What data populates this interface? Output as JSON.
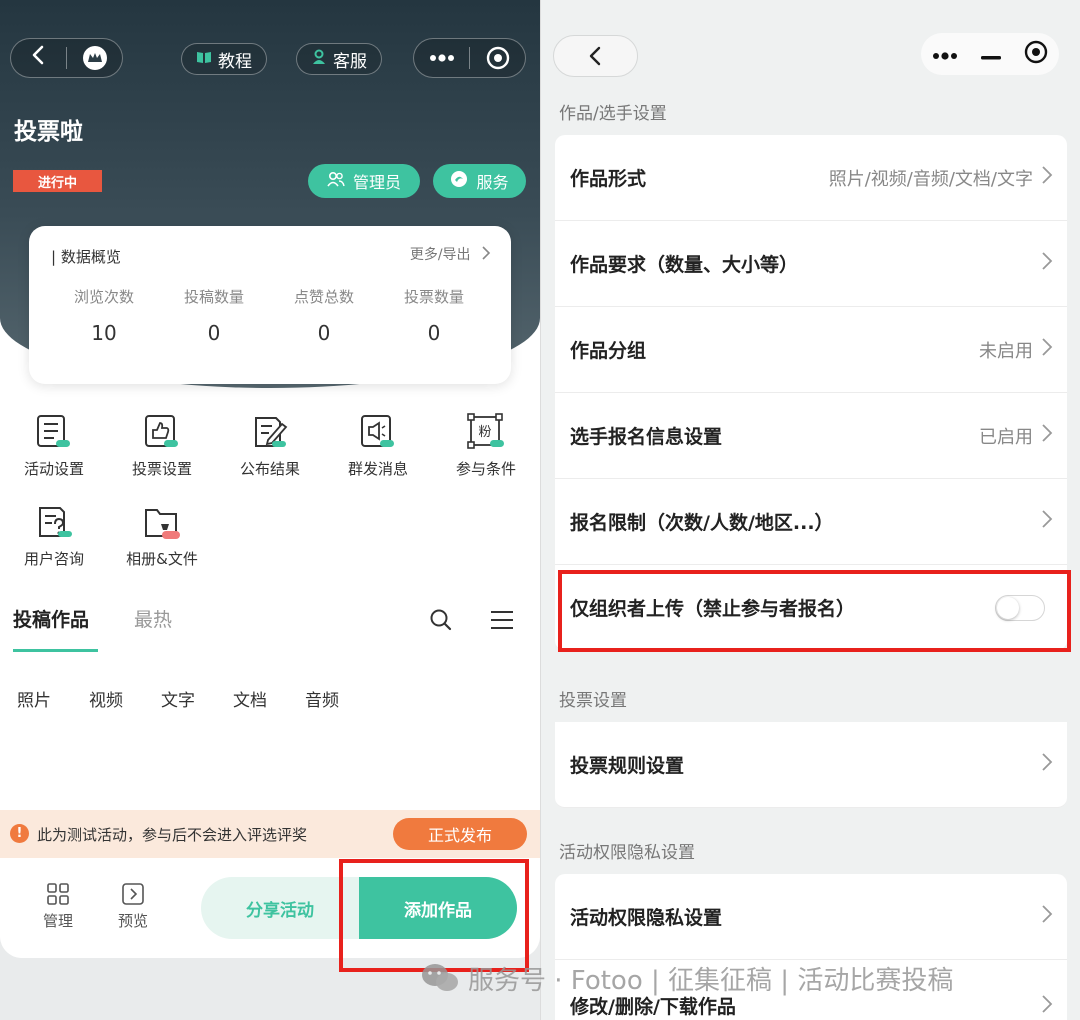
{
  "left": {
    "header": {
      "tutorial_label": "教程",
      "service_label": "客服"
    },
    "app_title": "投票啦",
    "status_tag": "进行中",
    "admin_button": "管理员",
    "service_button": "服务",
    "overview": {
      "title": "| 数据概览",
      "more_label": "更多/导出",
      "stats": [
        {
          "label": "浏览次数",
          "value": "10"
        },
        {
          "label": "投稿数量",
          "value": "0"
        },
        {
          "label": "点赞总数",
          "value": "0"
        },
        {
          "label": "投票数量",
          "value": "0"
        }
      ]
    },
    "grid": [
      {
        "label": "活动设置",
        "icon": "activity-settings-icon"
      },
      {
        "label": "投票设置",
        "icon": "thumbs-up-icon"
      },
      {
        "label": "公布结果",
        "icon": "edit-doc-icon"
      },
      {
        "label": "群发消息",
        "icon": "broadcast-icon"
      },
      {
        "label": "参与条件",
        "icon": "fan-condition-icon"
      },
      {
        "label": "用户咨询",
        "icon": "question-doc-icon"
      },
      {
        "label": "相册&文件",
        "icon": "folder-icon"
      }
    ],
    "fan_glyph": "粉",
    "tabs": {
      "main": "投稿作品",
      "hot": "最热"
    },
    "types": [
      "照片",
      "视频",
      "文字",
      "文档",
      "音频"
    ],
    "banner": {
      "text": "此为测试活动，参与后不会进入评选评奖",
      "publish_label": "正式发布",
      "warn_glyph": "!"
    },
    "bottom_nav": {
      "manage_label": "管理",
      "preview_label": "预览",
      "share_label": "分享活动",
      "add_label": "添加作品"
    }
  },
  "right": {
    "sections": [
      {
        "title": "作品/选手设置",
        "rows": [
          {
            "name": "作品形式",
            "value": "照片/视频/音频/文档/文字"
          },
          {
            "name": "作品要求（数量、大小等）",
            "value": ""
          },
          {
            "name": "作品分组",
            "value": "未启用"
          },
          {
            "name": "选手报名信息设置",
            "value": "已启用"
          },
          {
            "name": "报名限制（次数/人数/地区...）",
            "value": ""
          },
          {
            "name": "仅组织者上传（禁止参与者报名）",
            "value": "",
            "toggle": false
          }
        ]
      },
      {
        "title": "投票设置",
        "rows": [
          {
            "name": "投票规则设置",
            "value": ""
          }
        ]
      },
      {
        "title": "活动权限隐私设置",
        "rows": [
          {
            "name": "活动权限隐私设置",
            "value": ""
          },
          {
            "name": "修改/删除/下载作品",
            "value": ""
          }
        ]
      }
    ]
  },
  "watermark": "服务号 · Fotoo | 征集征稿 | 活动比赛投稿",
  "colors": {
    "accent": "#3ec3a0",
    "orange": "#f07a3e",
    "status_red": "#e8573f",
    "highlight_red": "#e8211c"
  }
}
